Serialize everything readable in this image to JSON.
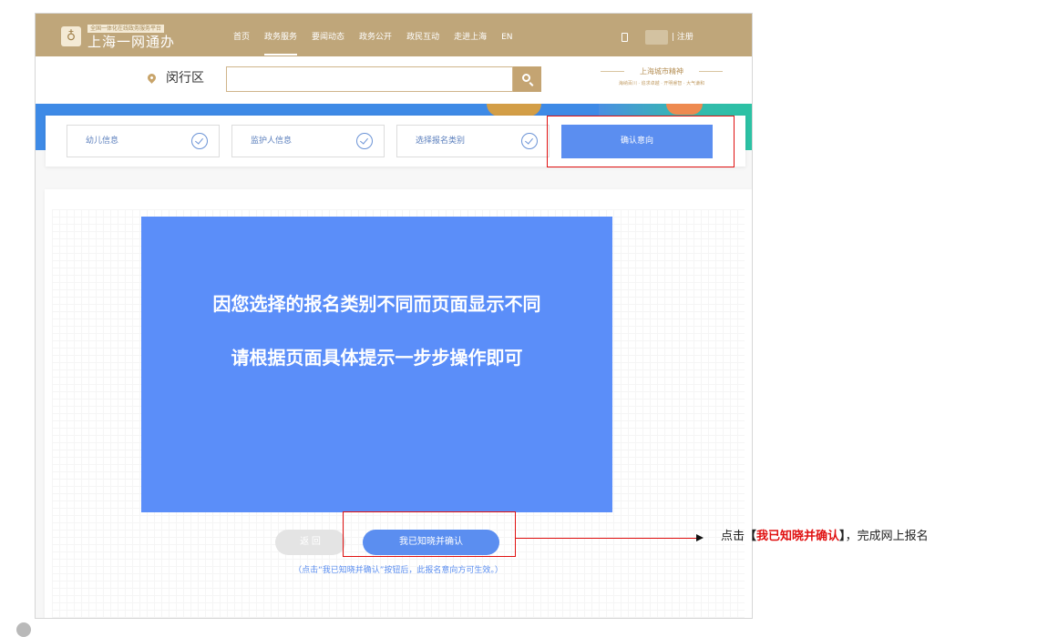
{
  "header": {
    "logo_subtitle": "全国一体化在线政务服务平台",
    "logo_title": "上海一网通办",
    "nav": [
      "首页",
      "政务服务",
      "要闻动态",
      "政务公开",
      "政民互动",
      "走进上海",
      "EN"
    ],
    "register": "| 注册"
  },
  "search": {
    "district": "闵行区",
    "placeholder": "",
    "spirit_title": "上海城市精神",
    "spirit_subtitle": "海纳百川 · 追求卓越 · 开明睿智 · 大气谦和"
  },
  "steps": {
    "items": [
      {
        "label": "幼儿信息"
      },
      {
        "label": "监护人信息"
      },
      {
        "label": "选择报名类别"
      }
    ],
    "current": "确认意向"
  },
  "notice": {
    "line1": "因您选择的报名类别不同而页面显示不同",
    "line2": "请根据页面具体提示一步步操作即可"
  },
  "actions": {
    "back_label": "返 回",
    "confirm_label": "我已知晓并确认",
    "hint": "（点击“我已知晓并确认”按钮后，此报名意向方可生效。）"
  },
  "annotation": {
    "prefix": "点击",
    "bracket_open": "【",
    "emphasis": "我已知晓并确认",
    "bracket_close": "】",
    "suffix": "，完成网上报名"
  },
  "colors": {
    "header_gold": "#bfa67a",
    "primary_blue": "#5b8ef0",
    "highlight_red": "#e01010"
  }
}
